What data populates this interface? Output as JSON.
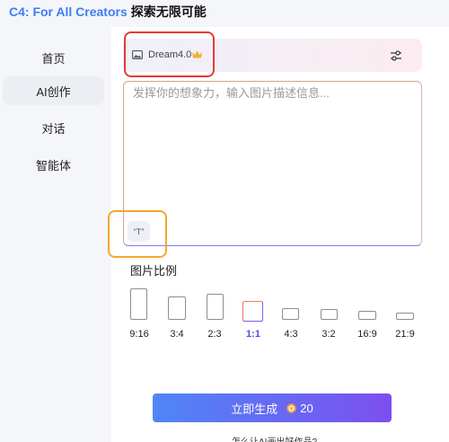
{
  "header": {
    "brand": "C4: For All Creators",
    "slogan": "探索无限可能"
  },
  "sidebar": {
    "items": [
      {
        "label": "首页"
      },
      {
        "label": "AI创作",
        "active": true
      },
      {
        "label": "对话"
      },
      {
        "label": "智能体"
      }
    ]
  },
  "model_selector": {
    "model_name": "Dream4.0",
    "image_icon": "image-icon",
    "premium_icon": "crown-icon",
    "settings_icon": "sliders-icon"
  },
  "prompt": {
    "placeholder": "发挥你的想象力，输入图片描述信息...",
    "value": "",
    "quote_button_label": "“T”"
  },
  "aspect_ratio": {
    "title": "图片比例",
    "selected": "1:1",
    "options": [
      "9:16",
      "3:4",
      "2:3",
      "1:1",
      "4:3",
      "3:2",
      "16:9",
      "21:9"
    ]
  },
  "generate": {
    "label": "立即生成",
    "cost": "20",
    "cost_icon": "coin-icon"
  },
  "tip": {
    "text": "怎么让AI画出好作品?"
  },
  "colors": {
    "brand": "#3b7ef7",
    "annotation_red": "#e53935",
    "annotation_orange": "#f4a72b",
    "button_gradient_start": "#4f86f6",
    "button_gradient_end": "#7d4ff0",
    "selected_ratio_text": "#4b4ef0"
  }
}
